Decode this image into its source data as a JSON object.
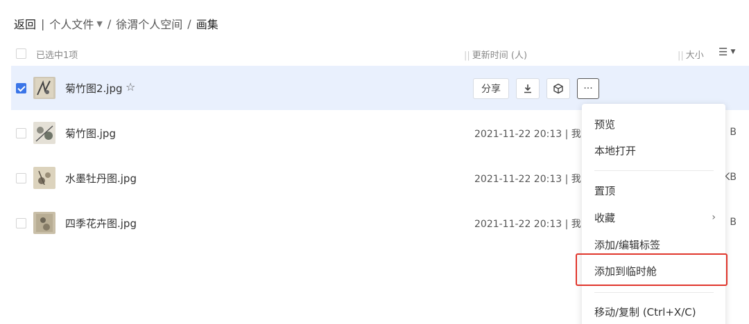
{
  "breadcrumb": {
    "back": "返回",
    "divider": "|",
    "root": "个人文件",
    "space": "徐渭个人空间",
    "current": "画集",
    "sep": "/"
  },
  "header": {
    "selected_label": "已选中1项",
    "col_time": "更新时间 (人)",
    "col_size": "大小",
    "bar": "||"
  },
  "files": [
    {
      "name": "菊竹图2.jpg",
      "selected": true,
      "time": "",
      "size": ""
    },
    {
      "name": "菊竹图.jpg",
      "selected": false,
      "time": "2021-11-22 20:13 | 我",
      "size": "B"
    },
    {
      "name": "水墨牡丹图.jpg",
      "selected": false,
      "time": "2021-11-22 20:13 | 我",
      "size": "KB"
    },
    {
      "name": "四季花卉图.jpg",
      "selected": false,
      "time": "2021-11-22 20:13 | 我",
      "size": "B"
    }
  ],
  "actions": {
    "share": "分享",
    "download_icon": "download-icon",
    "cube_icon": "cube-icon",
    "more": "···"
  },
  "menu": {
    "items": [
      {
        "label": "预览"
      },
      {
        "label": "本地打开"
      },
      {
        "label": "置顶"
      },
      {
        "label": "收藏",
        "arrow": "›"
      },
      {
        "label": "添加/编辑标签"
      },
      {
        "label": "添加到临时舱"
      },
      {
        "label": "移动/复制 (Ctrl+X/C)"
      }
    ],
    "highlight_color": "#e0352b"
  },
  "colors": {
    "accent": "#3a75e8",
    "selected_row": "#e9f0fd"
  }
}
